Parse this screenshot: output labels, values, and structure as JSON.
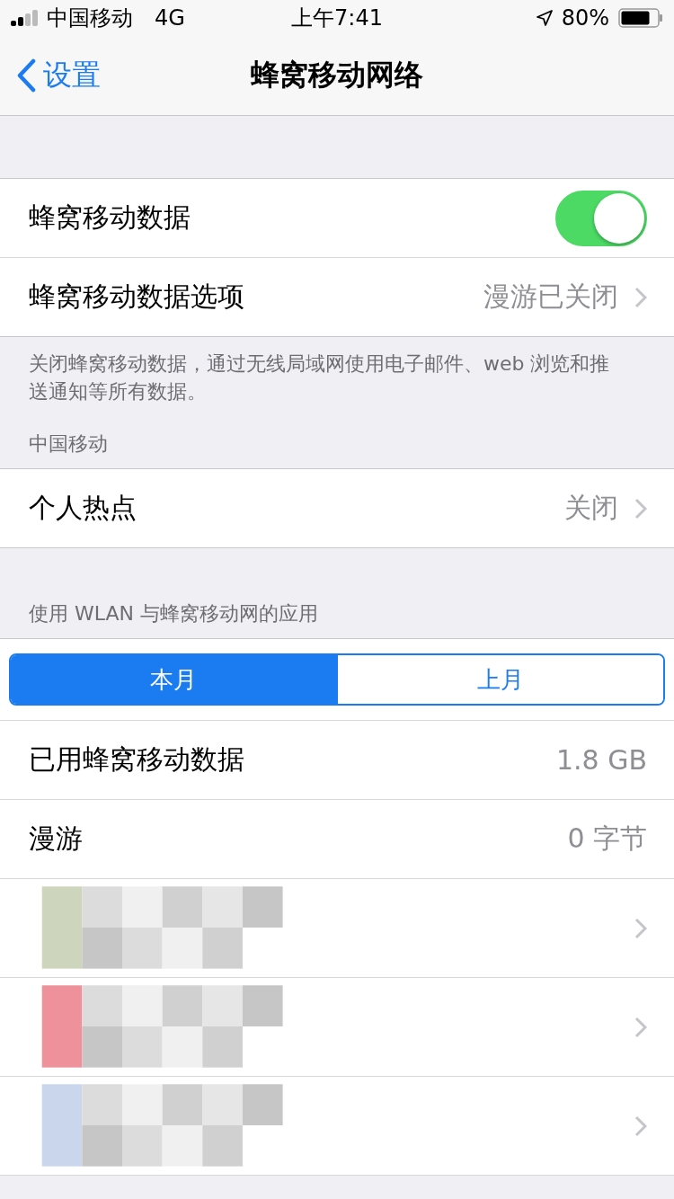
{
  "status_bar": {
    "carrier": "中国移动",
    "network": "4G",
    "time": "上午7:41",
    "battery": "80%"
  },
  "nav": {
    "back": "设置",
    "title": "蜂窝移动网络"
  },
  "section1": {
    "rows": [
      {
        "kind": "toggle",
        "label": "蜂窝移动数据",
        "on": true
      },
      {
        "kind": "link",
        "label": "蜂窝移动数据选项",
        "value": "漫游已关闭"
      }
    ],
    "footer": "关闭蜂窝移动数据，通过无线局域网使用电子邮件、web 浏览和推送通知等所有数据。"
  },
  "section2": {
    "header": "中国移动",
    "rows": [
      {
        "kind": "link",
        "label": "个人热点",
        "value": "关闭"
      }
    ]
  },
  "section3": {
    "header": "使用 WLAN 与蜂窝移动网的应用",
    "segments": [
      {
        "label": "本月",
        "selected": true
      },
      {
        "label": "上月",
        "selected": false
      }
    ],
    "rows": [
      {
        "kind": "value",
        "label": "已用蜂窝移动数据",
        "value": "1.8 GB"
      },
      {
        "kind": "value",
        "label": "漫游",
        "value": "0 字节"
      }
    ],
    "apps": [
      {
        "color": "#cdd6bd"
      },
      {
        "color": "#ee919b"
      },
      {
        "color": "#c9d6ec"
      }
    ]
  }
}
